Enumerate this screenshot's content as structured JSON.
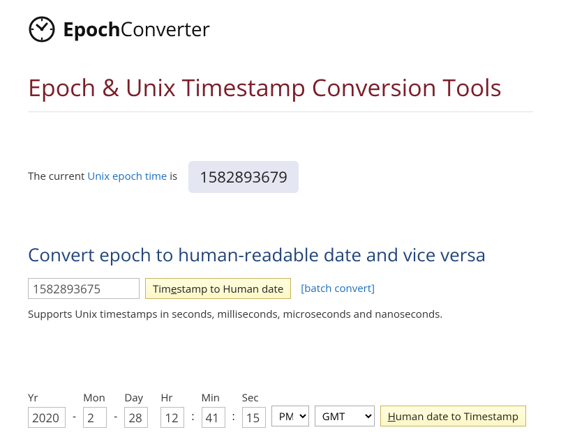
{
  "brand": {
    "bold": "Epoch",
    "light": "Converter"
  },
  "page": {
    "title": "Epoch & Unix Timestamp Conversion Tools",
    "current_prefix": "The current ",
    "current_link": "Unix epoch time",
    "current_suffix": " is",
    "current_value": "1582893679",
    "section_convert": "Convert epoch to human-readable date and vice versa",
    "ts_value": "1582893675",
    "ts_btn_prefix": "Tim",
    "ts_btn_u": "e",
    "ts_btn_suffix": "stamp to Human date",
    "batch_label": "[batch convert]",
    "support": "Supports Unix timestamps in seconds, milliseconds, microseconds and nanoseconds.",
    "hd_btn_u": "H",
    "hd_btn_suffix": "uman date to Timestamp"
  },
  "dt": {
    "labels": {
      "yr": "Yr",
      "mon": "Mon",
      "day": "Day",
      "hr": "Hr",
      "min": "Min",
      "sec": "Sec"
    },
    "values": {
      "yr": "2020",
      "mon": "2",
      "day": "28",
      "hr": "12",
      "min": "41",
      "sec": "15",
      "ampm": "PM",
      "tz": "GMT"
    },
    "sep": {
      "dash": "-",
      "colon": ":"
    }
  }
}
